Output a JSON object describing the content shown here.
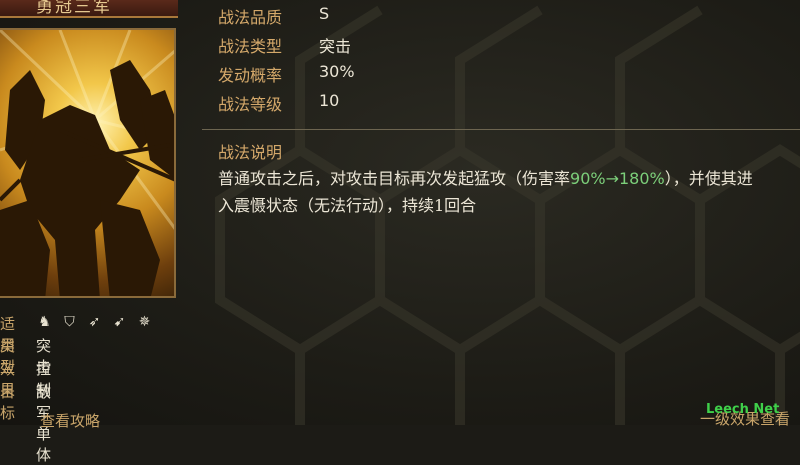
{
  "card": {
    "title": "勇冠三军"
  },
  "left_attributes": {
    "applicable_label": "适用",
    "applicable_icons": [
      "cavalry-icon",
      "shield-icon",
      "bow-icon",
      "spear-icon",
      "wheel-icon"
    ],
    "type_label": "类型",
    "type_value": "突击",
    "effect_label": "效果",
    "effect_value": "控制",
    "target_label": "目标",
    "target_value": "敌军单体",
    "guide_link": "查看攻略"
  },
  "stats": {
    "quality_label": "战法品质",
    "quality_value": "S",
    "type_label": "战法类型",
    "type_value": "突击",
    "rate_label": "发动概率",
    "rate_value": "30%",
    "level_label": "战法等级",
    "level_value": "10"
  },
  "description": {
    "title": "战法说明",
    "line1_a": "普通攻击之后，对攻击目标再次发起猛攻（伤害率",
    "line1_hl": "90%→180%",
    "line1_b": "），并使其进",
    "line2": "入震慑状态（无法行动），持续1回合"
  },
  "footer": {
    "text": "一级效果查看",
    "watermark": "Leech Net"
  },
  "colors": {
    "label_gold": "#d4a86a",
    "highlight_green": "#7ccf7a",
    "text": "#ece6d6"
  }
}
